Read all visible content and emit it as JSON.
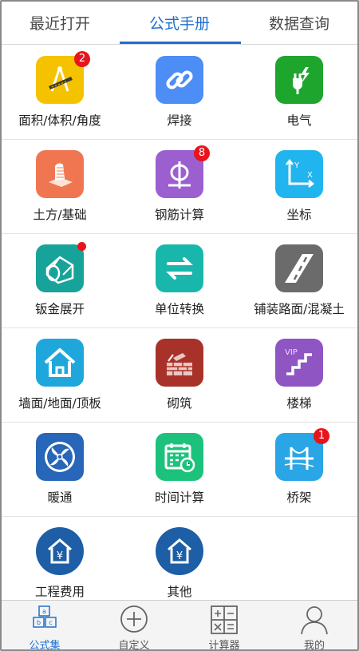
{
  "tabs": {
    "recent": "最近打开",
    "formula_manual": "公式手册",
    "data_query": "数据查询"
  },
  "items": [
    {
      "label": "面积/体积/角度",
      "icon": "ruler-compass-icon",
      "color": "#f5c200",
      "badge": "2"
    },
    {
      "label": "焊接",
      "icon": "chain-link-icon",
      "color": "#4c8df6",
      "badge": ""
    },
    {
      "label": "电气",
      "icon": "electric-plug-icon",
      "color": "#1ea52e",
      "badge": ""
    },
    {
      "label": "土方/基础",
      "icon": "foundation-icon",
      "color": "#f07651",
      "badge": ""
    },
    {
      "label": "钢筋计算",
      "icon": "rebar-icon",
      "color": "#9b5fd0",
      "badge": "8"
    },
    {
      "label": "坐标",
      "icon": "coordinate-axes-icon",
      "color": "#20b5ee",
      "badge": ""
    },
    {
      "label": "钣金展开",
      "icon": "sheet-metal-icon",
      "color": "#17a39a",
      "badge": "dot"
    },
    {
      "label": "单位转换",
      "icon": "exchange-arrows-icon",
      "color": "#19b7ab",
      "badge": ""
    },
    {
      "label": "铺装路面/混凝土",
      "icon": "road-icon",
      "color": "#6b6b6b",
      "badge": ""
    },
    {
      "label": "墙面/地面/顶板",
      "icon": "house-icon",
      "color": "#1fa7dc",
      "badge": ""
    },
    {
      "label": "砌筑",
      "icon": "brick-wall-icon",
      "color": "#a8322a",
      "badge": ""
    },
    {
      "label": "楼梯",
      "icon": "stairs-icon",
      "color": "#8e55c3",
      "badge": ""
    },
    {
      "label": "暖通",
      "icon": "fan-icon",
      "color": "#2766b8",
      "badge": ""
    },
    {
      "label": "时间计算",
      "icon": "calendar-clock-icon",
      "color": "#1cc27c",
      "badge": ""
    },
    {
      "label": "桥架",
      "icon": "bridge-icon",
      "color": "#2aa6e6",
      "badge": "1"
    },
    {
      "label": "工程费用",
      "icon": "yuan-house-icon",
      "color": "#1d5ea6",
      "badge": ""
    },
    {
      "label": "其他",
      "icon": "yuan-house-icon",
      "color": "#1d5ea6",
      "badge": ""
    }
  ],
  "bottom_nav": {
    "formula_set": "公式集",
    "custom": "自定义",
    "calculator": "计算器",
    "mine": "我的"
  },
  "colors": {
    "accent": "#1f6fcf",
    "badge": "#e8141b"
  }
}
